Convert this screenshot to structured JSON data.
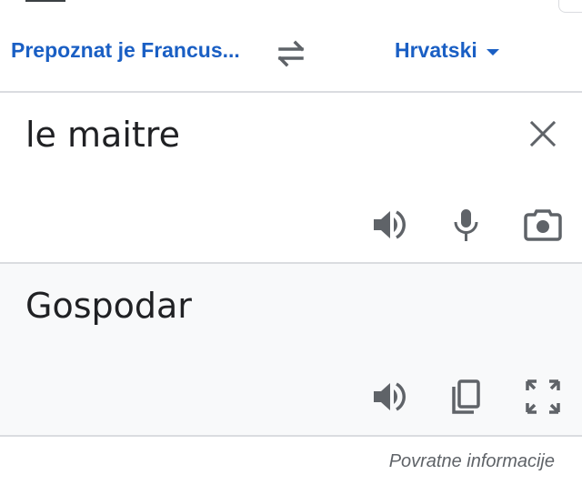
{
  "languages": {
    "source_label": "Prepoznat je Francus...",
    "target_label": "Hrvatski",
    "swap_icon": "swap-arrows-icon",
    "dropdown_icon": "caret-down-icon"
  },
  "input": {
    "text": "le maitre",
    "clear_icon": "close-icon",
    "actions": [
      "speaker-icon",
      "microphone-icon",
      "camera-icon"
    ]
  },
  "output": {
    "text": "Gospodar",
    "actions": [
      "speaker-icon",
      "copy-icon",
      "fullscreen-icon"
    ]
  },
  "footer": {
    "feedback_label": "Povratne informacije"
  },
  "colors": {
    "accent": "#1a5fc4",
    "icon": "#5f6368",
    "text": "#202124",
    "divider": "#dadce0",
    "output_bg": "#f8f9fa"
  }
}
